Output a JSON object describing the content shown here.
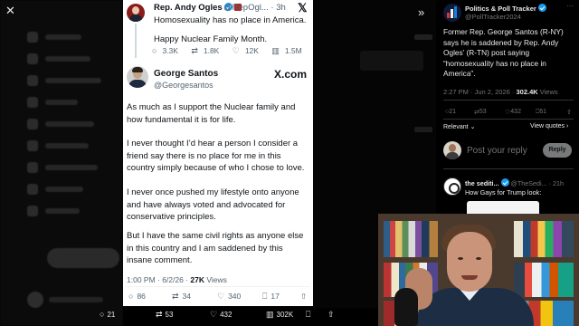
{
  "viewer": {
    "close_label": "✕",
    "collapse_label": "»"
  },
  "quoted": {
    "name": "Rep. Andy Ogles",
    "handle": "@RepOgl...",
    "time": "· 3h",
    "text1": "Homosexuality has no place in America.",
    "text2": "Happy Nuclear Family Month.",
    "stats": {
      "replies": "3.3K",
      "reposts": "1.8K",
      "likes": "12K",
      "views": "1.5M"
    }
  },
  "tweet": {
    "name": "George Santos",
    "handle": "@Georgesantos",
    "brand": "X.com",
    "paragraphs": [
      "As much as I support the Nuclear family and how fundamental it is for life.",
      "I never thought I’d hear a person I consider a friend say there is no place for me in this country simply because of who I chose to love.",
      "I never once pushed my lifestyle onto anyone and have always voted and advocated for conservative principles.",
      "But I have the same civil rights as anyone else in this country and I am saddened by this insane comment."
    ],
    "time": "1:00 PM · 6/2/26 ·",
    "views_count": "27K",
    "views_label": "Views",
    "stats": {
      "replies": "86",
      "reposts": "34",
      "likes": "340",
      "bookmarks": "17"
    }
  },
  "action_bar": {
    "replies": "21",
    "reposts": "53",
    "likes": "432",
    "views": "302K"
  },
  "panel": {
    "author_name": "Politics & Poll Tracker",
    "author_handle": "@PollTracker2024",
    "more": "···",
    "text": "Former Rep. George Santos (R-NY) says he is saddened by Rep. Andy Ogles’ (R-TN) post saying “homosexuality has no place in America”.",
    "meta_time": "2:27 PM · Jun 2, 2026 ·",
    "meta_views": "302.4K",
    "meta_views_label": "Views",
    "stats": {
      "replies": "21",
      "reposts": "53",
      "likes": "432",
      "bookmarks": "61"
    },
    "relevant": "Relevant ⌄",
    "view_quotes": "View quotes ›",
    "reply_placeholder": "Post your reply",
    "reply_button": "Reply",
    "reply2_name": "the sediti...",
    "reply2_handle": "@TheSedi... · 21h",
    "reply2_text": "How Gays for Trump look:"
  },
  "icons": {
    "reply": "○",
    "repost": "⇄",
    "like": "♡",
    "views": "▥",
    "bookmark": "⎕",
    "share": "⇧"
  },
  "colors": {
    "verified": "#1d9bf0",
    "card_bg": "#ffffff",
    "panel_bg": "#000000"
  }
}
